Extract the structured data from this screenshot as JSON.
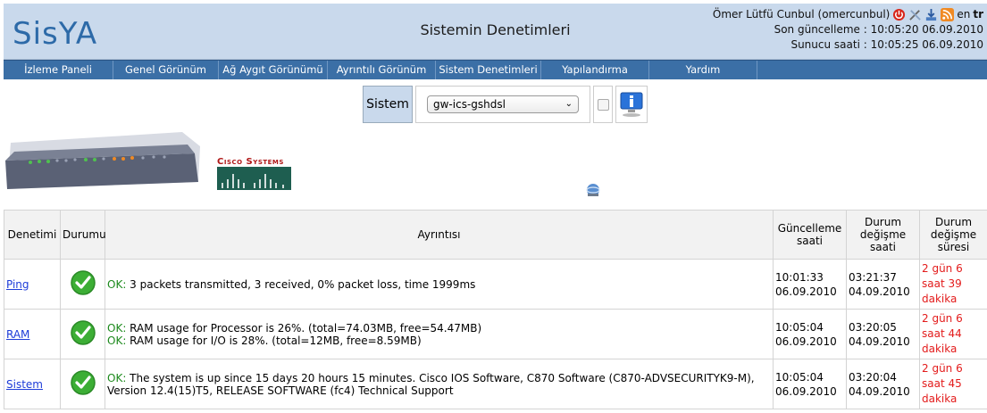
{
  "header": {
    "logo_left": "Sis",
    "logo_y": "Y",
    "logo_right": "A",
    "title": "Sistemin Denetimleri",
    "user": "Ömer Lütfü Cunbul (omercunbul)",
    "lang_en": "en",
    "lang_tr": "tr",
    "last_update": "Son güncelleme : 10:05:20 06.09.2010",
    "server_time": "Sunucu saati : 10:05:25 06.09.2010"
  },
  "nav": {
    "items": [
      "İzleme Paneli",
      "Genel Görünüm",
      "Ağ Aygıt Görünümü",
      "Ayrıntılı Görünüm",
      "Sistem Denetimleri",
      "Yapılandırma",
      "Yardım"
    ]
  },
  "toolbar": {
    "label": "Sistem",
    "selected": "gw-ics-gshdsl"
  },
  "vendor": {
    "name": "Cisco Systems"
  },
  "table": {
    "headers": {
      "check": "Denetimi",
      "status": "Durumu",
      "detail": "Ayrıntısı",
      "updated_a": "Güncelleme",
      "updated_b": "saati",
      "changed_a": "Durum",
      "changed_b": "değişme",
      "changed_c": "saati",
      "duration_a": "Durum",
      "duration_b": "değişme",
      "duration_c": "süresi"
    },
    "rows": [
      {
        "name": "Ping",
        "ok": "OK:",
        "detail1": " 3 packets transmitted, 3 received, 0% packet loss, time 1999ms",
        "ok2": "",
        "detail2": "",
        "upd_time": "10:01:33",
        "upd_date": "06.09.2010",
        "chg_time": "03:21:37",
        "chg_date": "04.09.2010",
        "dur1": "2 gün 6",
        "dur2": "saat 39",
        "dur3": "dakika"
      },
      {
        "name": "RAM",
        "ok": "OK:",
        "detail1": " RAM usage for Processor is 26%. (total=74.03MB, free=54.47MB)",
        "ok2": "OK:",
        "detail2": " RAM usage for I/O is 28%. (total=12MB, free=8.59MB)",
        "upd_time": "10:05:04",
        "upd_date": "06.09.2010",
        "chg_time": "03:20:05",
        "chg_date": "04.09.2010",
        "dur1": "2 gün 6",
        "dur2": "saat 44",
        "dur3": "dakika"
      },
      {
        "name": "Sistem",
        "ok": "OK:",
        "detail1": " The system is up since 15 days 20 hours 15 minutes. Cisco IOS Software, C870 Software (C870-ADVSECURITYK9-M),",
        "ok2": "",
        "detail2": "Version 12.4(15)T5, RELEASE SOFTWARE (fc4) Technical Support",
        "upd_time": "10:05:04",
        "upd_date": "06.09.2010",
        "chg_time": "03:20:04",
        "chg_date": "04.09.2010",
        "dur1": "2 gün 6",
        "dur2": "saat 45",
        "dur3": "dakika"
      }
    ]
  },
  "colors": {
    "header_bg": "#c9d9ec",
    "nav_bg": "#3b6fa6",
    "ok_green": "#1d8a1d",
    "duration_red": "#e31b1b",
    "link_blue": "#1d3cd8"
  }
}
